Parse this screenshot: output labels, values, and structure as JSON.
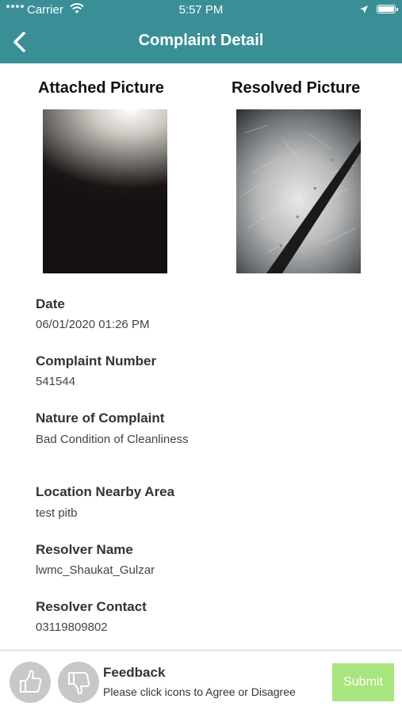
{
  "status_bar": {
    "carrier": "Carrier",
    "time": "5:57 PM"
  },
  "nav": {
    "title": "Complaint Detail"
  },
  "pictures": {
    "attached_label": "Attached Picture",
    "resolved_label": "Resolved Picture"
  },
  "details": {
    "date_label": "Date",
    "date_value": "06/01/2020 01:26 PM",
    "complaint_number_label": "Complaint Number",
    "complaint_number_value": "541544",
    "nature_label": "Nature of Complaint",
    "nature_value": "Bad Condition of Cleanliness",
    "location_label": "Location Nearby Area",
    "location_value": "test pitb",
    "resolver_name_label": "Resolver Name",
    "resolver_name_value": "lwmc_Shaukat_Gulzar",
    "resolver_contact_label": "Resolver Contact",
    "resolver_contact_value": "03119809802"
  },
  "feedback": {
    "title": "Feedback",
    "subtitle": "Please click icons to Agree or Disagree",
    "submit_label": "Submit",
    "submit_color": "#a9e57f"
  },
  "colors": {
    "header": "#3a8f97"
  }
}
